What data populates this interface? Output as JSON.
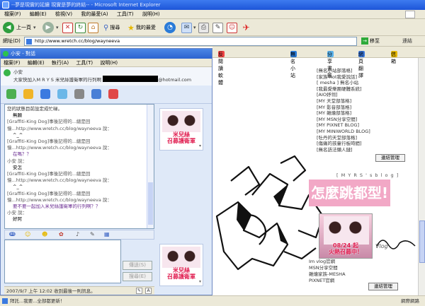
{
  "ie": {
    "title": "--夢是現實的延續 現實是夢的終結-- - Microsoft Internet Explorer",
    "menu": [
      "檔案(F)",
      "編輯(E)",
      "檢視(V)",
      "我的最愛(A)",
      "工具(T)",
      "說明(H)"
    ],
    "toolbar": {
      "back": "上一頁",
      "search": "搜尋",
      "favorites": "我的最愛"
    },
    "address": {
      "label": "網址(D)",
      "value": "http://www.wretch.cc/blog/wayneeva",
      "go": "移至",
      "links": "連結"
    },
    "status": {
      "text": "拜託...我要...全部都更新！",
      "zone": "網際網路"
    }
  },
  "page_toolbar": {
    "bookmarks": "反閱讀軟體",
    "search_google": "無名小站",
    "share": "分享書籤",
    "translate": "網頁翻譯",
    "mail": "信箱"
  },
  "links_list": [
    "[無名小站部落格]",
    "[家族-hot我愛說話]",
    "[ mesha ] 無名小站",
    "[我最愛樂團硬體系統]",
    "[AIO妤翎]",
    "[MY 天堂部落格]",
    "[MY 影音部落格]",
    "[MY 雜燴部落格]",
    "[MY MSN分享空間]",
    "[MY PIXNET BLOG]",
    "[MY MINIWORLD BLOG]",
    "[牡丹的天堂部落格]",
    "[傷痛的孩童行板時間]",
    "[無名語法懶人鏈]"
  ],
  "manage_button": "連結管理",
  "myrs_caption": "[ M Y R S ' s  b l o g ]",
  "hurry_banner": "怎麼跳都型!",
  "banner_text": [
    "08/24 起",
    "火熱召募中！"
  ],
  "vlog_sign": "Vlog",
  "links_list2": [
    "Im vlog官網",
    "MSN分享空間",
    "雜燴家族-MESHA",
    "PIXNET官網"
  ],
  "msn": {
    "title": "小安 - 對話",
    "menu": [
      "檔案(F)",
      "編輯(E)",
      "執行(A)",
      "工具(T)",
      "說明(H)"
    ],
    "contact_name": "小安",
    "contact_status": "大家快加入M R Y S 米兒絲護衛軍的行列啊",
    "contact_email_suffix": "@hotmail.com",
    "chat_lines": [
      {
        "cls": "st",
        "text": "您的狀態目前設定成忙碌。"
      },
      {
        "cls": "blk",
        "text": "無願"
      },
      {
        "cls": "nm",
        "text": "[Graffiti-King Dog]事後記得的...總是回"
      },
      {
        "cls": "nm",
        "text": "憶...http://www.wretch.cc/blog/wayneeva 說："
      },
      {
        "cls": "blk",
        "text": "^_^"
      },
      {
        "cls": "nm",
        "text": "[Graffiti-King Dog]事後記得的...總是回"
      },
      {
        "cls": "nm",
        "text": "憶...http://www.wretch.cc/blog/wayneeva 說："
      },
      {
        "cls": "pur",
        "text": "在嗎？？"
      },
      {
        "cls": "nm",
        "text": "小安 說："
      },
      {
        "cls": "blk",
        "text": "安怎"
      },
      {
        "cls": "nm",
        "text": "[Graffiti-King Dog]事後記得的...總是回"
      },
      {
        "cls": "nm",
        "text": "憶...http://www.wretch.cc/blog/wayneeva 說："
      },
      {
        "cls": "blk",
        "text": "^_^"
      },
      {
        "cls": "nm",
        "text": "[Graffiti-King Dog]事後記得的...總是回"
      },
      {
        "cls": "nm",
        "text": "憶...http://www.wretch.cc/blog/wayneeva 說："
      },
      {
        "cls": "pur",
        "text": "要不要一起加入米兒絲護衛軍的行列啊？？"
      },
      {
        "cls": "nm",
        "text": "小安 說："
      },
      {
        "cls": "blk",
        "text": "好阿"
      }
    ],
    "send_button": "傳送(S)",
    "search_button": "搜尋(E)",
    "status_bar": "2007/9/7 上午 12:02 收到最後一則訊息。",
    "avatar_text": [
      "米兒絲",
      "召募護衛軍"
    ]
  }
}
